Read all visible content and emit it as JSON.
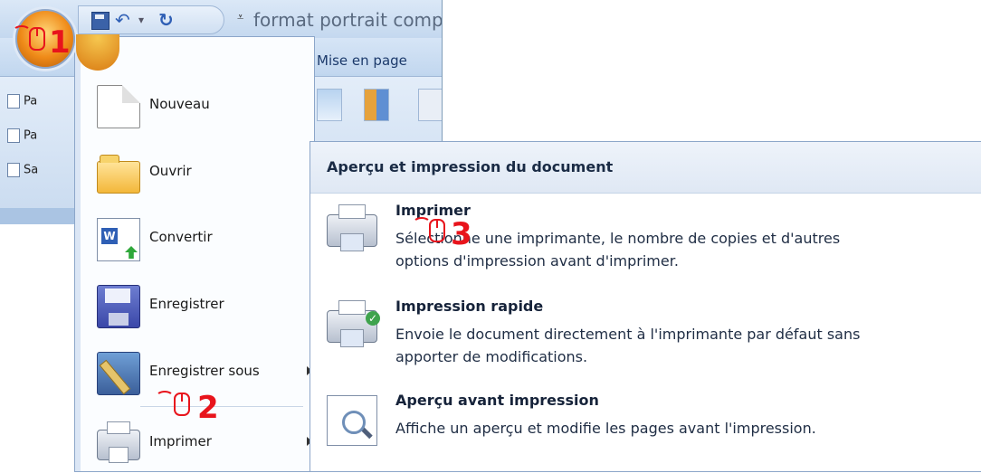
{
  "window": {
    "doc_title": "format portrait comp",
    "tab_label": "Mise en page",
    "ribbon_items": [
      "Pa",
      "Pa",
      "Sa"
    ]
  },
  "office_menu": {
    "items": [
      {
        "label": "Nouveau",
        "icon": "new-document-icon"
      },
      {
        "label": "Ouvrir",
        "icon": "open-folder-icon"
      },
      {
        "label": "Convertir",
        "icon": "convert-icon"
      },
      {
        "label": "Enregistrer",
        "icon": "save-icon"
      },
      {
        "label": "Enregistrer sous",
        "icon": "save-as-icon",
        "submenu": true
      },
      {
        "label": "Imprimer",
        "icon": "printer-icon",
        "submenu": true
      }
    ]
  },
  "print_submenu": {
    "header": "Aperçu et impression du document",
    "options": [
      {
        "title": "Imprimer",
        "desc_line1": "Sélectionne une imprimante, le nombre de copies et d'autres",
        "desc_line2": "options d'impression avant d'imprimer.",
        "icon": "printer-icon"
      },
      {
        "title": "Impression rapide",
        "desc_line1": "Envoie le document directement à l'imprimante par défaut sans",
        "desc_line2": "apporter de modifications.",
        "icon": "quick-print-icon"
      },
      {
        "title": "Aperçu avant impression",
        "desc_line1": "Affiche un aperçu et modifie les pages avant l'impression.",
        "icon": "print-preview-icon"
      }
    ]
  },
  "annotations": {
    "step1": "1",
    "step2": "2",
    "step3": "3",
    "color": "#e8141c"
  }
}
